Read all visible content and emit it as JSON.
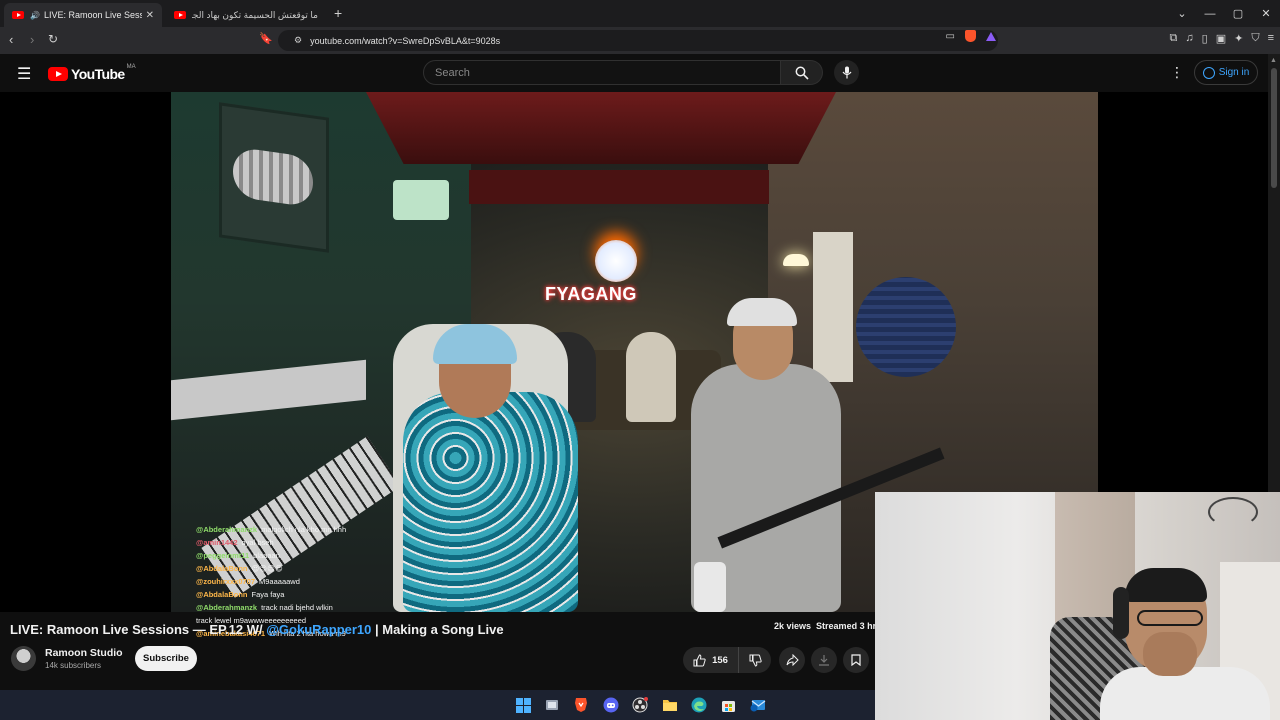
{
  "browser": {
    "tabs": [
      {
        "title": "LIVE: Ramoon Live Sessions —",
        "active": true
      },
      {
        "title": "ما توقعتش الحسيمة تكون بهاد الجمال |",
        "active": false
      }
    ],
    "url": "youtube.com/watch?v=SwreDpSvBLA&t=9028s"
  },
  "youtube": {
    "logo_text": "YouTube",
    "country_code": "MA",
    "search_placeholder": "Search",
    "signin_label": "Sign in"
  },
  "video": {
    "brand_sign": "FYAGANG",
    "chat": [
      {
        "user": "@Abderahmanzk",
        "msg": "malgolich nla kho mn hhhhhh",
        "color": "#8fdc6a"
      },
      {
        "user": "@amin1442",
        "msg": "dyal bseh",
        "color": "#e05a6a"
      },
      {
        "user": "@peggeinmt11",
        "msg": "blaaaan",
        "color": "#8fdc6a"
      },
      {
        "user": "@AbdalaBonn",
        "msg": "😍😍😍😍",
        "color": "#ffb84a"
      },
      {
        "user": "@zouhirxxx0707",
        "msg": "M9aaaaawd",
        "color": "#ffb84a"
      },
      {
        "user": "@AbdalaBonn",
        "msg": "Faya faya",
        "color": "#ffb84a"
      },
      {
        "user": "@Abderahmanzk",
        "msg": "track nadi bjehd wlkin track lewel m9awwweeeeeeeeed",
        "color": "#8fdc6a"
      },
      {
        "user": "@aminebakasi4671",
        "msg": "Wlh hta 2 hta howa m9wd",
        "color": "#ffb84a"
      }
    ]
  },
  "meta": {
    "title_prefix": "LIVE: Ramoon Live Sessions — EP.12 W/ ",
    "title_mention": "@GokuRapper10",
    "title_suffix": " | Making a Song Live",
    "views": "2k views",
    "streamed": "Streamed 3 hr",
    "channel_name": "Ramoon Studio",
    "subscribers": "14k subscribers",
    "subscribe_label": "Subscribe",
    "likes": "156"
  },
  "colors": {
    "accent_blue": "#3ea6ff",
    "youtube_red": "#ff0000",
    "background": "#0f0f0f"
  }
}
